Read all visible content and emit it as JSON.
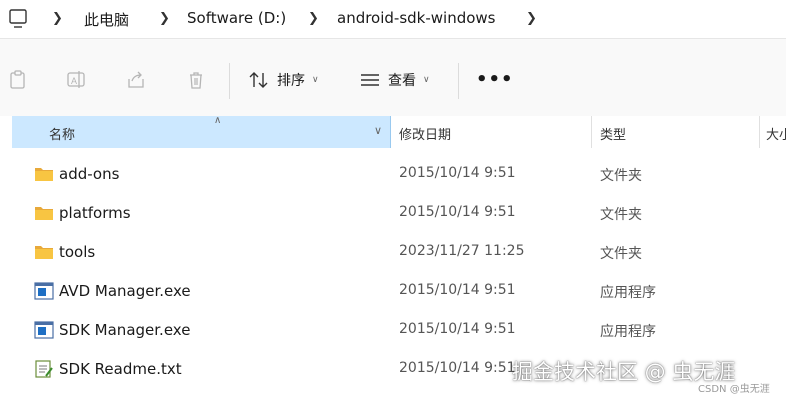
{
  "breadcrumb": {
    "items": [
      "此电脑",
      "Software (D:)",
      "android-sdk-windows"
    ]
  },
  "toolbar": {
    "sort_label": "排序",
    "view_label": "查看",
    "more_label": "•••"
  },
  "columns": {
    "name": "名称",
    "date": "修改日期",
    "type": "类型",
    "size": "大小"
  },
  "rows": [
    {
      "name": "add-ons",
      "date": "2015/10/14 9:51",
      "type": "文件夹",
      "icon": "folder-icon"
    },
    {
      "name": "platforms",
      "date": "2015/10/14 9:51",
      "type": "文件夹",
      "icon": "folder-icon"
    },
    {
      "name": "tools",
      "date": "2023/11/27 11:25",
      "type": "文件夹",
      "icon": "folder-icon"
    },
    {
      "name": "AVD Manager.exe",
      "date": "2015/10/14 9:51",
      "type": "应用程序",
      "icon": "exe-icon"
    },
    {
      "name": "SDK Manager.exe",
      "date": "2015/10/14 9:51",
      "type": "应用程序",
      "icon": "exe-icon"
    },
    {
      "name": "SDK Readme.txt",
      "date": "2015/10/14 9:51",
      "type": "",
      "icon": "text-file-icon"
    }
  ],
  "watermark": "掘金技术社区 @ 虫无涯",
  "watermark_small": "CSDN @虫无涯",
  "colors": {
    "selected_header": "#cce8ff",
    "folder": "#f8c542",
    "exe_blue": "#1e6fc4"
  }
}
